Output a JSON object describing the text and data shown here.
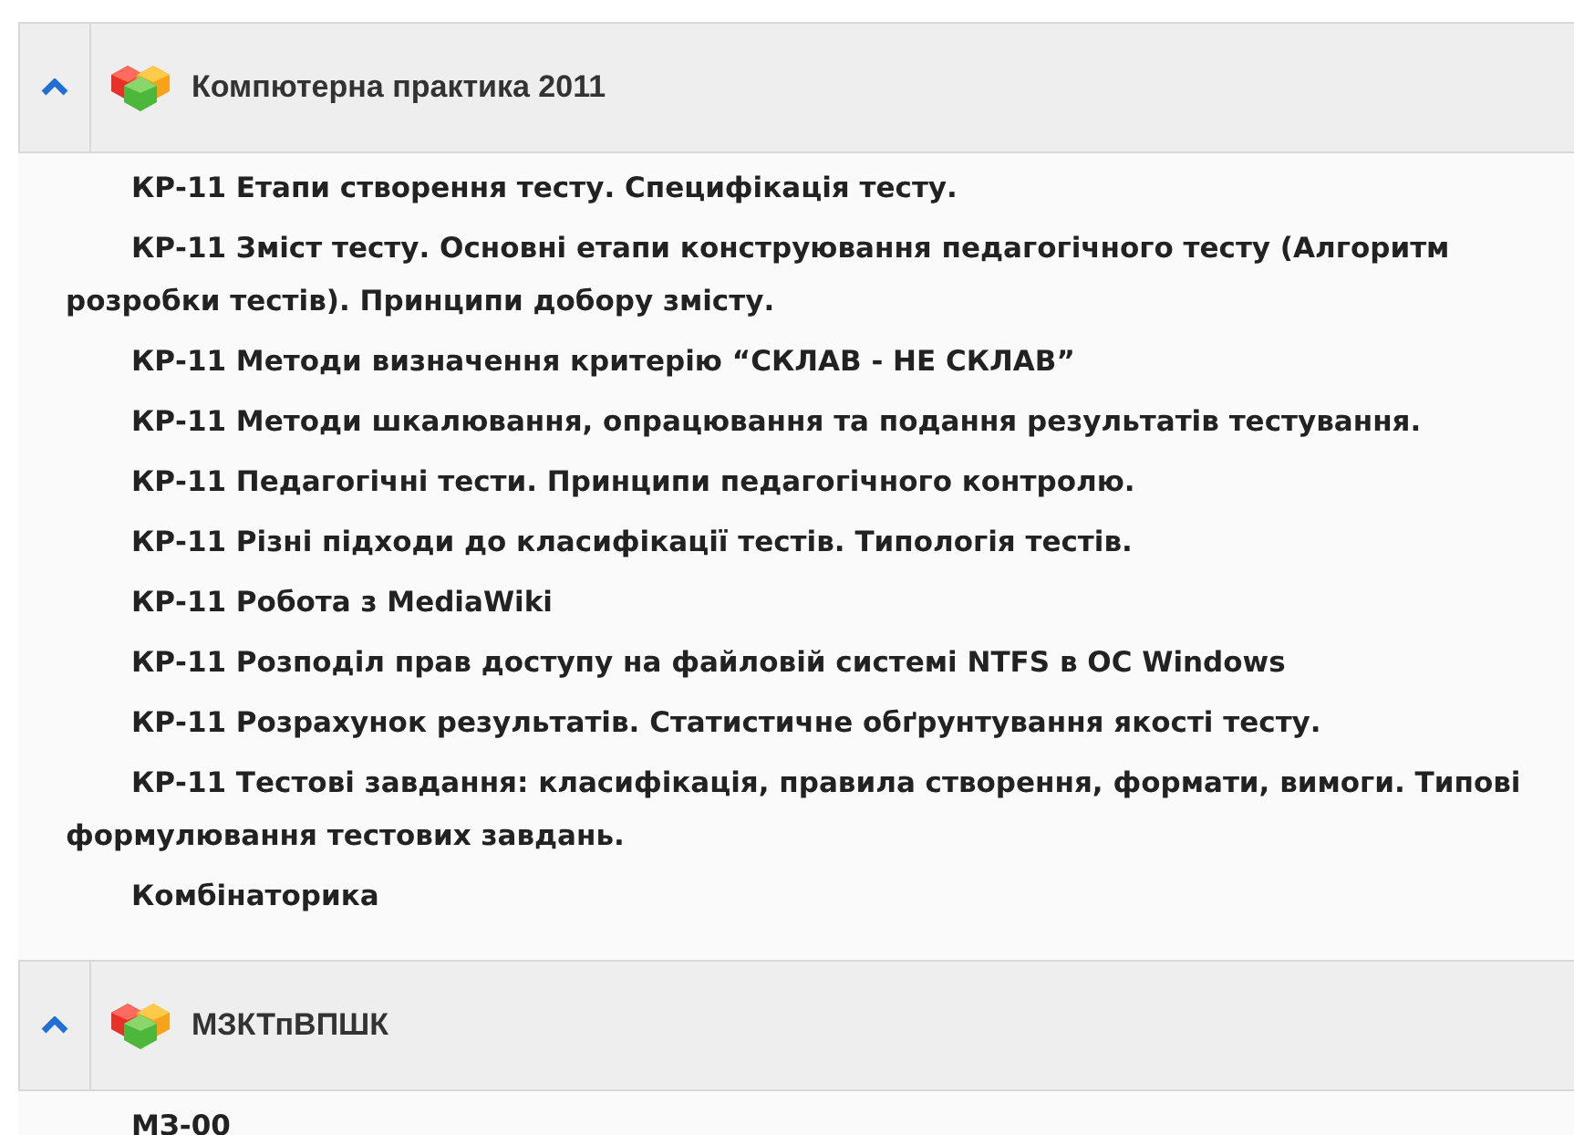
{
  "sections": [
    {
      "title": "Компютерна практика 2011",
      "expanded": true,
      "items": [
        "КР-11 Етапи створення тесту. Специфікація тесту.",
        "КР-11 Зміст тесту. Основні етапи конструювання педагогічного тесту (Алгоритм розробки тестів). Принципи добору змісту.",
        "КР-11 Методи визначення критерію “СКЛАВ - НЕ СКЛАВ”",
        "КР-11 Методи шкалювання, опрацювання та подання результатів тестування.",
        "КР-11 Педагогічні тести. Принципи педагогічного контролю.",
        "КР-11 Різні підходи до класифікації тестів. Типологія тестів.",
        "КР-11 Робота з MediaWiki",
        "КР-11 Розподіл прав доступу на файловій системі NTFS в ОС Windows",
        "КР-11 Розрахунок результатів. Статистичне обґрунтування якості тесту.",
        "КР-11 Тестові завдання: класифікація, правила створення, формати, вимоги. Типові формулювання тестових завдань.",
        "Комбінаторика"
      ]
    },
    {
      "title": "МЗКТпВПШК",
      "expanded": true,
      "items": [
        "МЗ-00"
      ]
    }
  ]
}
